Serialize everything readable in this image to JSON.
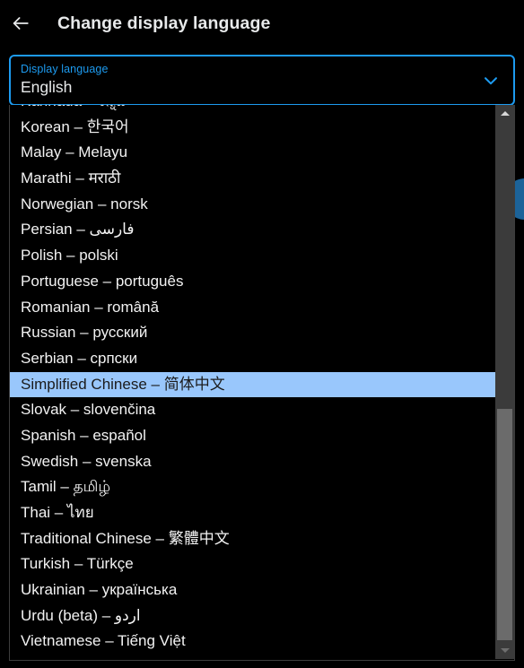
{
  "header": {
    "back_icon": "arrow-left-icon",
    "title": "Change display language"
  },
  "combobox": {
    "label": "Display language",
    "value": "English",
    "chevron_icon": "chevron-down-icon",
    "accent_color": "#1d9bf0"
  },
  "dropdown": {
    "selected_value": "Simplified Chinese – 简体中文",
    "highlight_color": "#99c7fc",
    "options": [
      "Kannada – ಕನ್ನಡ",
      "Korean – 한국어",
      "Malay – Melayu",
      "Marathi – मराठी",
      "Norwegian – norsk",
      "Persian – فارسی",
      "Polish – polski",
      "Portuguese – português",
      "Romanian – română",
      "Russian – русский",
      "Serbian – српски",
      "Simplified Chinese – 简体中文",
      "Slovak – slovenčina",
      "Spanish – español",
      "Swedish – svenska",
      "Tamil – தமிழ்",
      "Thai – ไทย",
      "Traditional Chinese – 繁體中文",
      "Turkish – Türkçe",
      "Ukrainian – українська",
      "Urdu (beta) – اردو",
      "Vietnamese – Tiếng Việt"
    ]
  },
  "scrollbar": {
    "up_icon": "scroll-up-arrow-icon",
    "down_icon": "scroll-down-arrow-icon"
  },
  "floating_action_button": {
    "name": "compose-button",
    "color": "#1c6399"
  }
}
